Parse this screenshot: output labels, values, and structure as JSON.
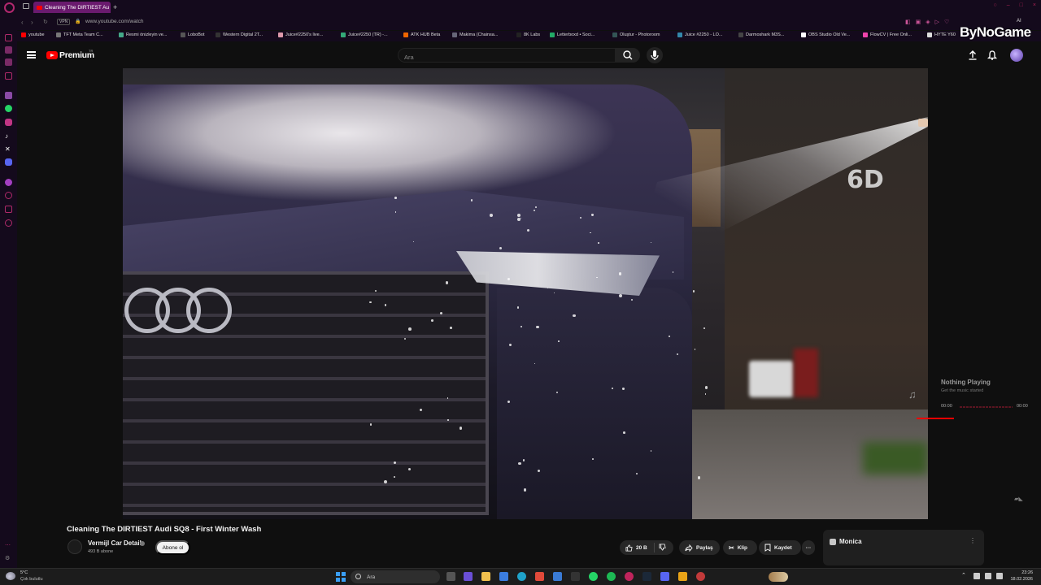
{
  "browser": {
    "tab_title": "Cleaning The DIRTIEST Au",
    "url": "www.youtube.com/watch",
    "vpn_label": "VPN",
    "bookmarks": [
      "youtube",
      "TFT Meta Team C...",
      "Resmi önizleyin ve...",
      "LoboBot",
      "Western Digital 2T...",
      "Juice#2250's live...",
      "Juice#2250 (TR) -...",
      "ATK HUB Beta",
      "Makima (Chainsa...",
      "8K Labs",
      "Letterboxd • Soci...",
      "Oluştur - Photoroom",
      "Juice #2250 - LO...",
      "Darmoshark M3S...",
      "OBS Studio Old Ve...",
      "FlowCV | Free Onli...",
      "HYTE Y60"
    ],
    "watermark": "ByNoGame",
    "window_label": "AI"
  },
  "youtube": {
    "logo_text": "Premium",
    "country_code": "TR",
    "search_placeholder": "Ara",
    "video": {
      "badge_text": "6D"
    },
    "music_widget": {
      "title": "Nothing Playing",
      "subtitle": "Get the music started",
      "time_start": "00:00",
      "time_end": "00:00",
      "progress": 0
    },
    "title": "Cleaning The DIRTIEST Audi SQ8 - First Winter Wash",
    "channel": {
      "name": "Vermijl Car Detail",
      "subscribers": "493 B abone",
      "subscribe_label": "Abone ol"
    },
    "actions": {
      "likes": "20 B",
      "share_label": "Paylaş",
      "clip_label": "Klip",
      "save_label": "Kaydet",
      "more_label": "···"
    },
    "monica": {
      "label": "Monica",
      "more": "⋮"
    }
  },
  "taskbar": {
    "weather_temp": "5°C",
    "weather_desc": "Çok bulutlu",
    "search_placeholder": "Ara",
    "time": "23:26",
    "date": "18.02.2026"
  }
}
